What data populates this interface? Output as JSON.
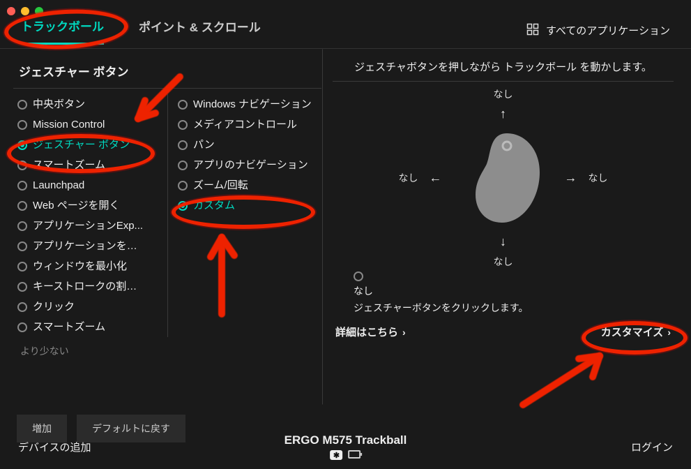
{
  "traffic_lights": true,
  "tabs": {
    "trackball": "トラックボール",
    "point_scroll": "ポイント & スクロール"
  },
  "all_apps_label": "すべてのアプリケーション",
  "section_title": "ジェスチャー ボタン",
  "instruction": "ジェスチャボタンを押しながら トラックボール を動かします。",
  "button_actions": [
    {
      "label": "中央ボタン",
      "selected": false
    },
    {
      "label": "Mission Control",
      "selected": false
    },
    {
      "label": "ジェスチャー ボタン",
      "selected": true
    },
    {
      "label": "スマートズーム",
      "selected": false
    },
    {
      "label": "Launchpad",
      "selected": false
    },
    {
      "label": "Web ページを開く",
      "selected": false
    },
    {
      "label": "アプリケーションExp...",
      "selected": false
    },
    {
      "label": "アプリケーションを…",
      "selected": false
    },
    {
      "label": "ウィンドウを最小化",
      "selected": false
    },
    {
      "label": "キーストロークの割…",
      "selected": false
    },
    {
      "label": "クリック",
      "selected": false
    },
    {
      "label": "スマートズーム",
      "selected": false
    }
  ],
  "gesture_modes": [
    {
      "label": "Windows ナビゲーション",
      "selected": false
    },
    {
      "label": "メディアコントロール",
      "selected": false
    },
    {
      "label": "パン",
      "selected": false
    },
    {
      "label": "アプリのナビゲーション",
      "selected": false
    },
    {
      "label": "ズーム/回転",
      "selected": false
    },
    {
      "label": "カスタム",
      "selected": true
    }
  ],
  "less_label": "より少ない",
  "buttons": {
    "add": "増加",
    "reset": "デフォルトに戻す"
  },
  "directions": {
    "up": "なし",
    "down": "なし",
    "left": "なし",
    "right": "なし"
  },
  "click_action": {
    "value": "なし",
    "description": "ジェスチャーボタンをクリックします。"
  },
  "links": {
    "details": "詳細はこちら",
    "customize": "カスタマイズ"
  },
  "footer": {
    "add_device": "デバイスの追加",
    "device_name": "ERGO M575 Trackball",
    "login": "ログイン"
  }
}
